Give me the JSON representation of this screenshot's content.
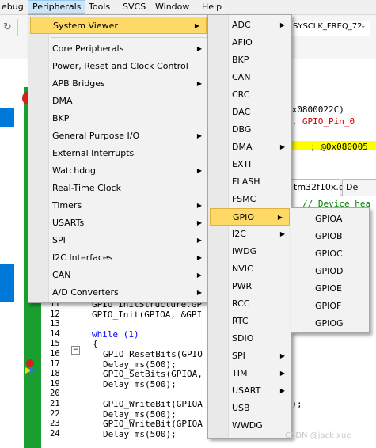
{
  "menubar": {
    "items": [
      {
        "label": "ebug"
      },
      {
        "label": "Peripherals"
      },
      {
        "label": "Tools"
      },
      {
        "label": "SVCS"
      },
      {
        "label": "Window"
      },
      {
        "label": "Help"
      }
    ]
  },
  "toolbar": {
    "target_combo": "SYSCLK_FREQ_72"
  },
  "editor": {
    "tab_label": "tm32f10x.c",
    "tab2_label": "De",
    "disasm": [
      "0x0800022C)",
      "A, GPIO_Pin_0",
      "; @0x080005",
      "// Device hea"
    ],
    "code_lines": [
      {
        "num": "11",
        "text": "GPIO_InitStructure.GP"
      },
      {
        "num": "12",
        "text": "GPIO_Init(GPIOA, &GPI"
      },
      {
        "num": "13",
        "text": ""
      },
      {
        "num": "14",
        "text": "while (1)"
      },
      {
        "num": "15",
        "text": "{"
      },
      {
        "num": "16",
        "text": "GPIO_ResetBits(GPIO"
      },
      {
        "num": "17",
        "text": "Delay_ms(500);"
      },
      {
        "num": "18",
        "text": "GPIO_SetBits(GPIOA,"
      },
      {
        "num": "19",
        "text": "Delay_ms(500);"
      },
      {
        "num": "20",
        "text": ""
      },
      {
        "num": "21",
        "text": "GPIO_WriteBit(GPIOA         it_RESET);"
      },
      {
        "num": "22",
        "text": "Delay_ms(500);"
      },
      {
        "num": "23",
        "text": "GPIO_WriteBit(GPIOA         SET);"
      },
      {
        "num": "24",
        "text": "Delay_ms(500);"
      }
    ]
  },
  "peripherals_menu": {
    "items": [
      {
        "label": "System Viewer",
        "submenu": true
      },
      {
        "label": "Core Peripherals",
        "submenu": true
      },
      {
        "label": "Power, Reset and Clock Control",
        "submenu": false
      },
      {
        "label": "APB Bridges",
        "submenu": true
      },
      {
        "label": "DMA",
        "submenu": false
      },
      {
        "label": "BKP",
        "submenu": false
      },
      {
        "label": "General Purpose I/O",
        "submenu": true
      },
      {
        "label": "External Interrupts",
        "submenu": false
      },
      {
        "label": "Watchdog",
        "submenu": true
      },
      {
        "label": "Real-Time Clock",
        "submenu": false
      },
      {
        "label": "Timers",
        "submenu": true
      },
      {
        "label": "USARTs",
        "submenu": true
      },
      {
        "label": "SPI",
        "submenu": true
      },
      {
        "label": "I2C Interfaces",
        "submenu": true
      },
      {
        "label": "CAN",
        "submenu": true
      },
      {
        "label": "A/D Converters",
        "submenu": true
      }
    ]
  },
  "system_viewer_menu": {
    "items": [
      {
        "label": "ADC",
        "submenu": true
      },
      {
        "label": "AFIO",
        "submenu": false
      },
      {
        "label": "BKP",
        "submenu": false
      },
      {
        "label": "CAN",
        "submenu": false
      },
      {
        "label": "CRC",
        "submenu": false
      },
      {
        "label": "DAC",
        "submenu": false
      },
      {
        "label": "DBG",
        "submenu": false
      },
      {
        "label": "DMA",
        "submenu": true
      },
      {
        "label": "EXTI",
        "submenu": false
      },
      {
        "label": "FLASH",
        "submenu": false
      },
      {
        "label": "FSMC",
        "submenu": false
      },
      {
        "label": "GPIO",
        "submenu": true
      },
      {
        "label": "I2C",
        "submenu": true
      },
      {
        "label": "IWDG",
        "submenu": false
      },
      {
        "label": "NVIC",
        "submenu": false
      },
      {
        "label": "PWR",
        "submenu": false
      },
      {
        "label": "RCC",
        "submenu": false
      },
      {
        "label": "RTC",
        "submenu": false
      },
      {
        "label": "SDIO",
        "submenu": false
      },
      {
        "label": "SPI",
        "submenu": true
      },
      {
        "label": "TIM",
        "submenu": true
      },
      {
        "label": "USART",
        "submenu": true
      },
      {
        "label": "USB",
        "submenu": false
      },
      {
        "label": "WWDG",
        "submenu": false
      }
    ]
  },
  "gpio_menu": {
    "items": [
      {
        "label": "GPIOA"
      },
      {
        "label": "GPIOB"
      },
      {
        "label": "GPIOC"
      },
      {
        "label": "GPIOD"
      },
      {
        "label": "GPIOE"
      },
      {
        "label": "GPIOF"
      },
      {
        "label": "GPIOG"
      }
    ]
  },
  "watermark": "CSDN @jack xue",
  "colors": {
    "highlight": "#ffd966",
    "gutter_green": "#1a9e30",
    "keyword": "#0000ff",
    "number": "#800080"
  }
}
